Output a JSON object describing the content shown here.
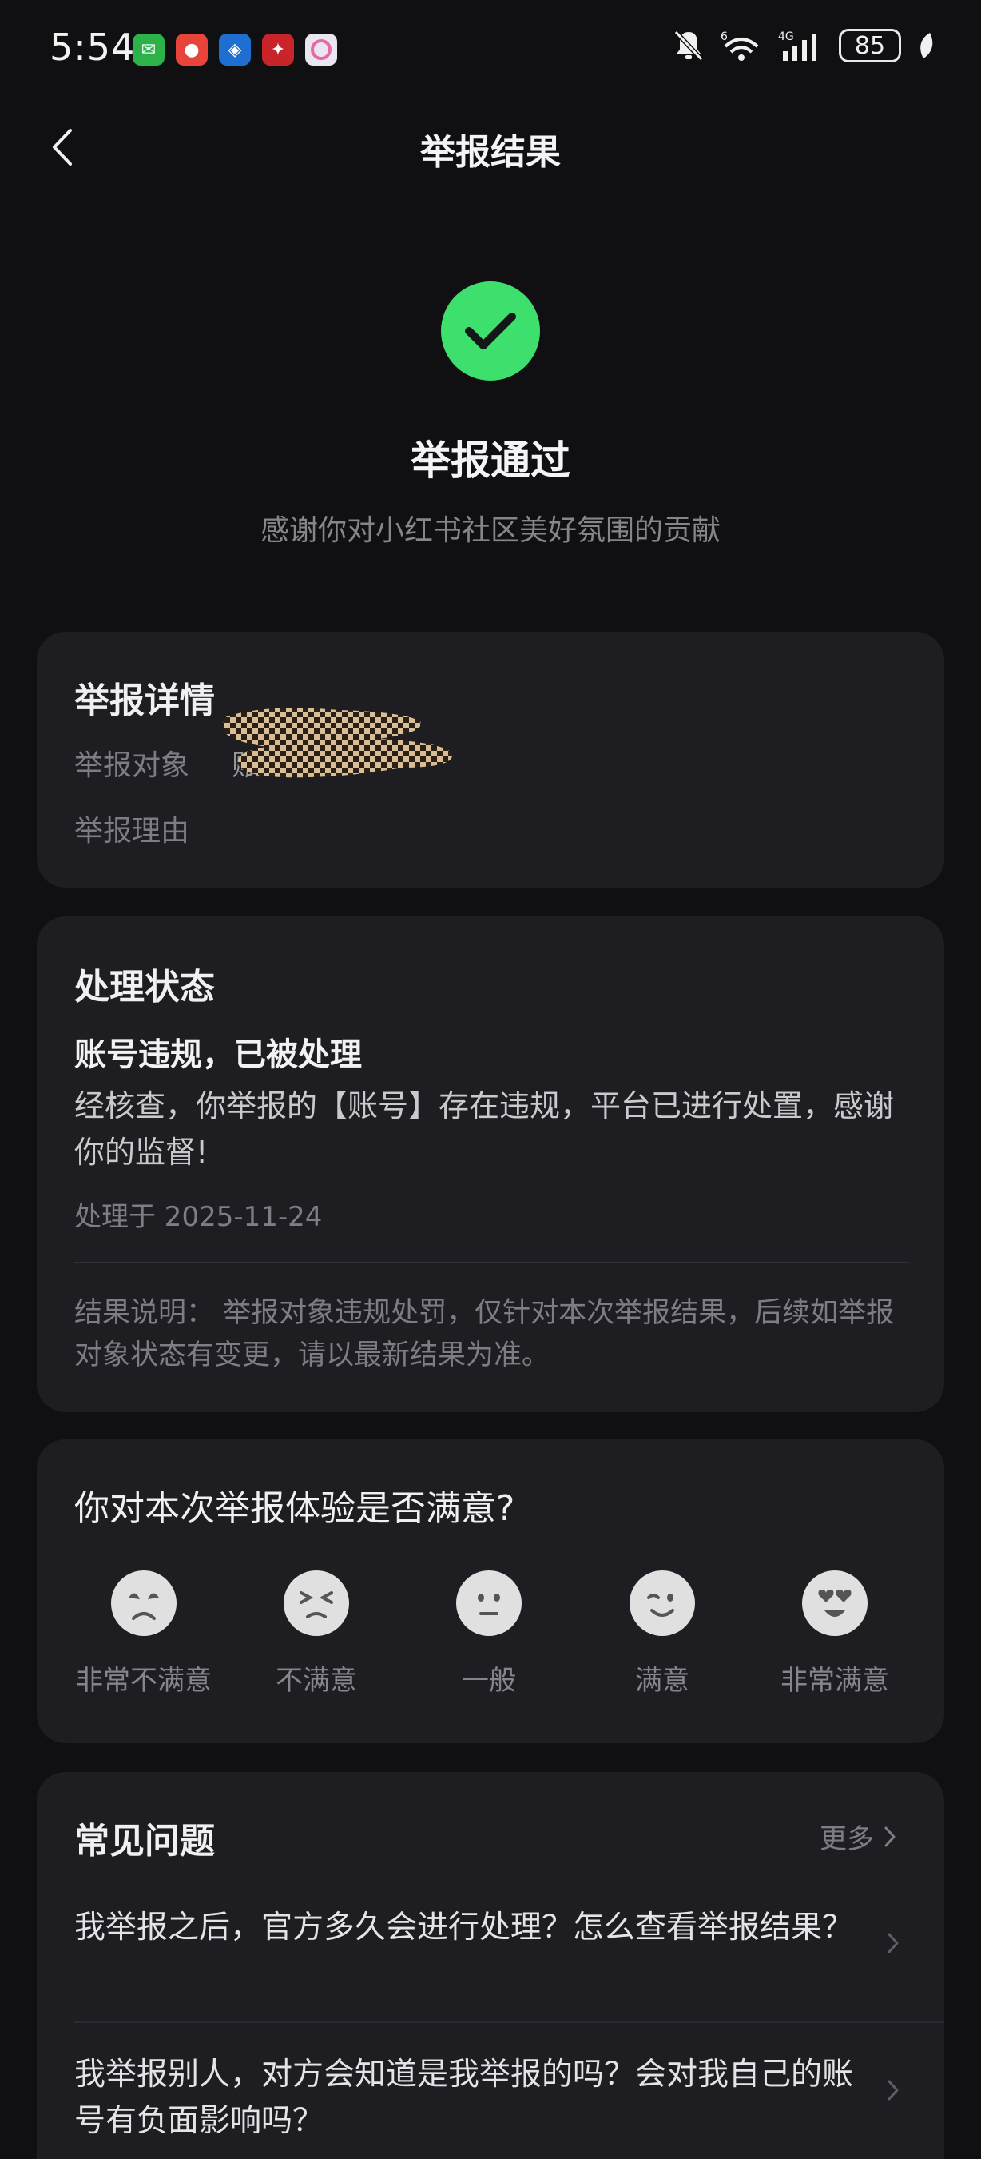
{
  "status_bar": {
    "time": "5:54",
    "network": "4G",
    "wifi_badge": "6",
    "battery": "85"
  },
  "nav": {
    "title": "举报结果"
  },
  "result": {
    "title": "举报通过",
    "subtitle": "感谢你对小红书社区美好氛围的贡献",
    "icon_color": "#3ee06d"
  },
  "details": {
    "title": "举报详情",
    "target_label": "举报对象",
    "target_value": "账",
    "reason_label": "举报理由"
  },
  "status": {
    "title": "处理状态",
    "headline": "账号违规，已被处理",
    "description": "经核查，你举报的【账号】存在违规，平台已进行处置，感谢你的监督!",
    "date": "处理于 2025-11-24",
    "note": "结果说明： 举报对象违规处罚，仅针对本次举报结果，后续如举报对象状态有变更，请以最新结果为准。"
  },
  "survey": {
    "question": "你对本次举报体验是否满意?",
    "options": [
      {
        "label": "非常不满意",
        "icon": "very-dissatisfied-face-icon"
      },
      {
        "label": "不满意",
        "icon": "dissatisfied-face-icon"
      },
      {
        "label": "一般",
        "icon": "neutral-face-icon"
      },
      {
        "label": "满意",
        "icon": "satisfied-face-icon"
      },
      {
        "label": "非常满意",
        "icon": "very-satisfied-face-icon"
      }
    ]
  },
  "faq": {
    "title": "常见问题",
    "more": "更多",
    "items": [
      "我举报之后，官方多久会进行处理？怎么查看举报结果？",
      "我举报别人，对方会知道是我举报的吗？会对我自己的账号有负面影响吗？"
    ]
  }
}
